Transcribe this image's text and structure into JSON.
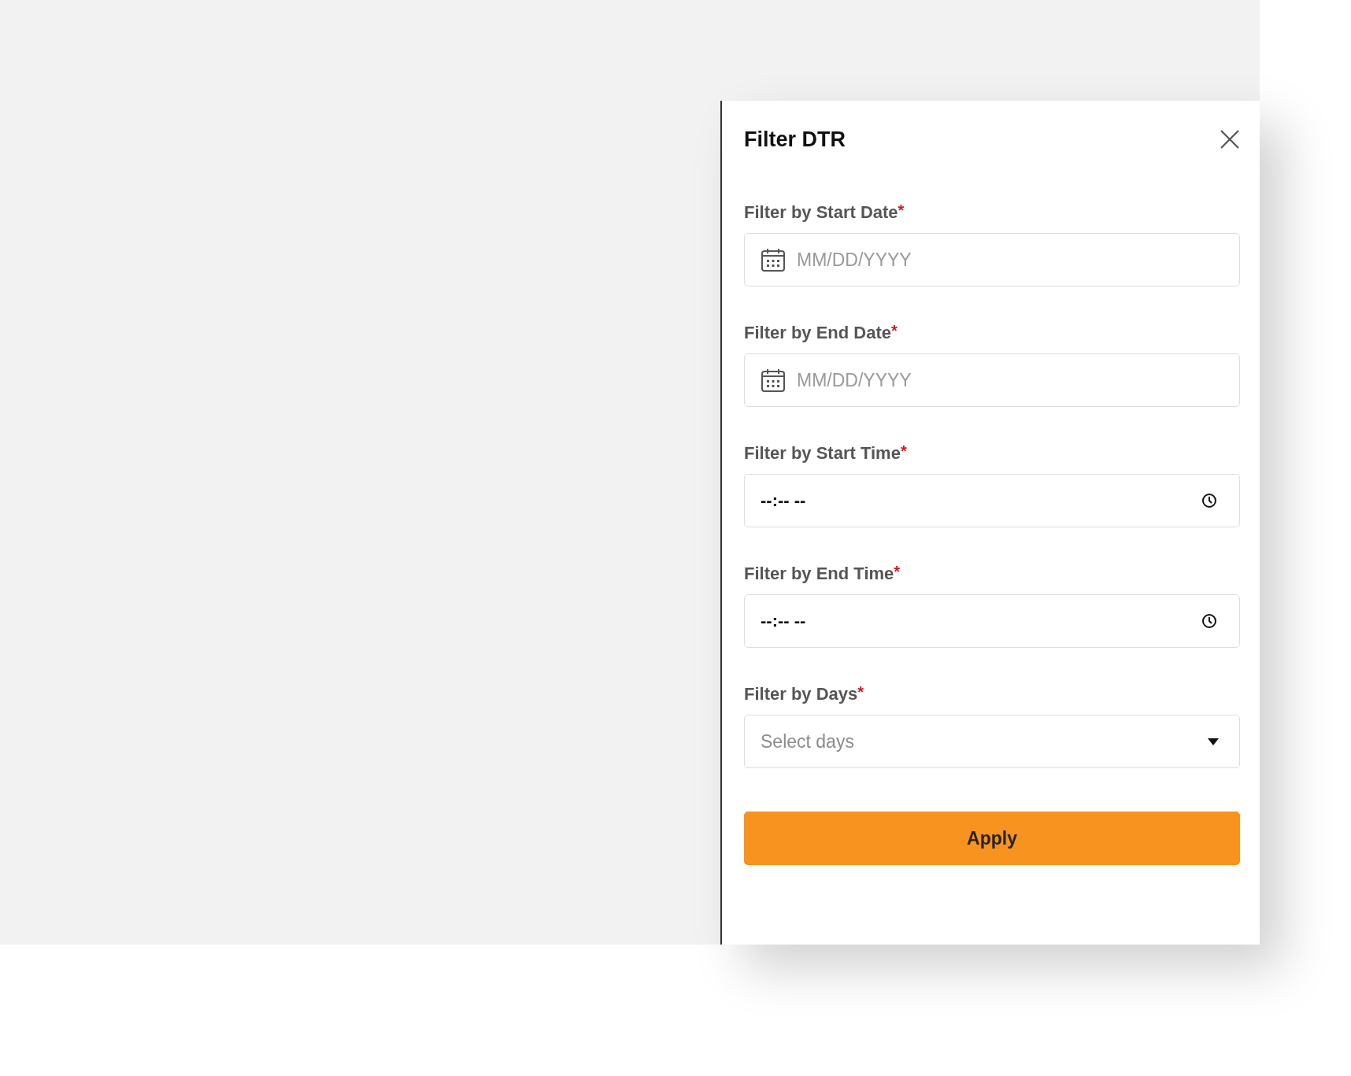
{
  "panel": {
    "title": "Filter DTR",
    "fields": [
      {
        "kind": "date",
        "label": "Filter by Start Date",
        "required_mark": "*",
        "placeholder": "MM/DD/YYYY"
      },
      {
        "kind": "date",
        "label": "Filter by End Date",
        "required_mark": "*",
        "placeholder": "MM/DD/YYYY"
      },
      {
        "kind": "time",
        "label": "Filter by Start Time",
        "required_mark": "*",
        "value": "--:-- --"
      },
      {
        "kind": "time",
        "label": "Filter by End Time",
        "required_mark": "*",
        "value": "--:-- --"
      },
      {
        "kind": "select",
        "label": "Filter by Days",
        "required_mark": "*",
        "placeholder": "Select days"
      }
    ],
    "apply_button": "Apply"
  }
}
